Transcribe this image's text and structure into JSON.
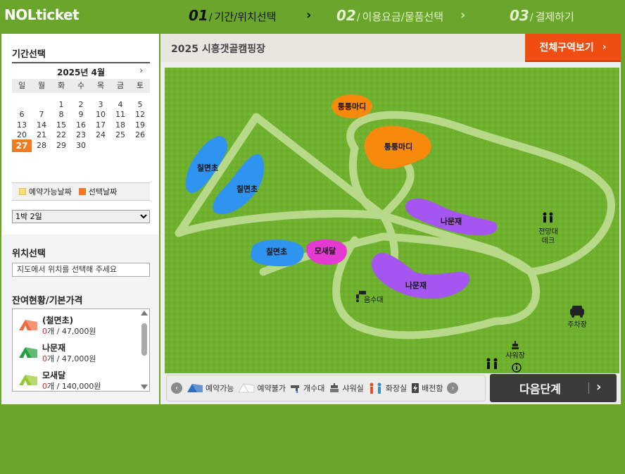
{
  "header": {
    "logo": "NOLticket",
    "steps": [
      {
        "num": "01",
        "label": "기간/위치선택"
      },
      {
        "num": "02",
        "label": "이용요금/물품선택"
      },
      {
        "num": "03",
        "label": "결제하기"
      }
    ],
    "active_step": 1
  },
  "left": {
    "period_title": "기간선택",
    "calendar": {
      "month_label": "2025년 4월",
      "next_label": "›",
      "weekdays": [
        "일",
        "월",
        "화",
        "수",
        "목",
        "금",
        "토"
      ],
      "days": [
        "",
        "",
        "1",
        "2",
        "3",
        "4",
        "5",
        "6",
        "7",
        "8",
        "9",
        "10",
        "11",
        "12",
        "13",
        "14",
        "15",
        "16",
        "17",
        "18",
        "19",
        "20",
        "21",
        "22",
        "23",
        "24",
        "25",
        "26",
        "27",
        "28",
        "29",
        "30"
      ],
      "selected_day": "27"
    },
    "legend": {
      "available": "예약가능날짜",
      "selected": "선택날짜"
    },
    "stay_select": {
      "value": "1박 2일"
    },
    "location_title": "위치선택",
    "location_hint": "지도에서 위치를 선택해 주세요",
    "stock_title": "잔여현황/기본가격",
    "stock_items": [
      {
        "name": "(철면초)",
        "count": "0",
        "unit": "개 / ",
        "price": "47,000원",
        "color": "#f06a3c"
      },
      {
        "name": "나문재",
        "count": "0",
        "unit": "개 / ",
        "price": "47,000원",
        "color": "#1f9e3a"
      },
      {
        "name": "모새달",
        "count": "0",
        "unit": "개 / ",
        "price": "140,000원",
        "color": "#97c934"
      }
    ]
  },
  "map": {
    "title": "2025 시흥갯골캠핑장",
    "all_button": "전체구역보기",
    "zones": {
      "tongtong_small": "퉁퉁마디",
      "tongtong_large": "퉁퉁마디",
      "chilmyeon_1": "칠면초",
      "chilmyeon_2": "칠면초",
      "chilmyeon_3": "칠면초",
      "mosaedal": "모새달",
      "namunjae_1": "나문재",
      "namunjae_2": "나문재"
    },
    "pois": {
      "observatory": "전망대",
      "deck": "데크",
      "water": "음수대",
      "parking": "주차장",
      "shower": "샤워장"
    },
    "colors": {
      "grass": "#6fb12e",
      "path": "#b9d98a",
      "orange": "#f78a0d",
      "blue": "#2f93f0",
      "purple": "#a555f0",
      "magenta": "#e43ad2"
    }
  },
  "legend_bar": {
    "prev": "‹",
    "next": "›",
    "items": [
      "예약가능",
      "예약불가",
      "개수대",
      "샤워실",
      "화장실",
      "배전함"
    ]
  },
  "next_button": "다음단계"
}
